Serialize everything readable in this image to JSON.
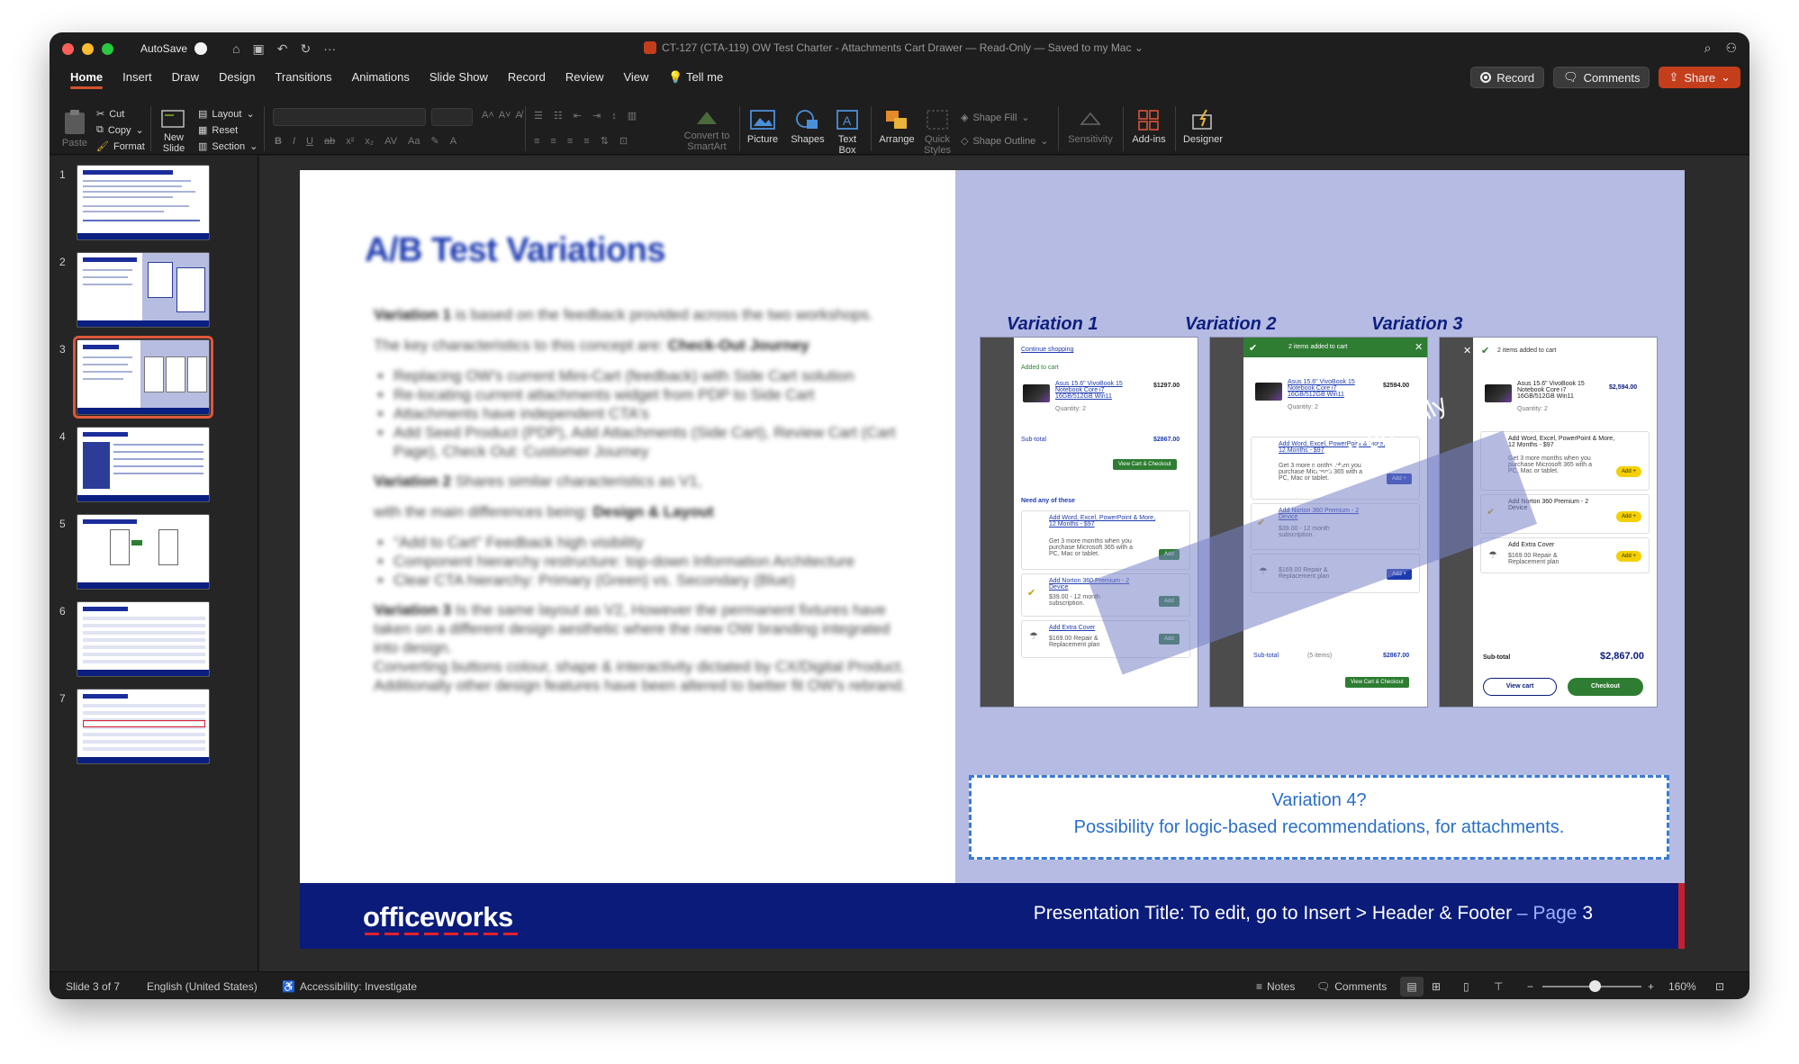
{
  "titlebar": {
    "autosave": "AutoSave",
    "document_title": "CT-127 (CTA-119) OW Test Charter - Attachments Cart Drawer  —  Read-Only  —  Saved to my Mac ⌄"
  },
  "tabs": [
    "Home",
    "Insert",
    "Draw",
    "Design",
    "Transitions",
    "Animations",
    "Slide Show",
    "Record",
    "Review",
    "View",
    "Tell me"
  ],
  "header_buttons": {
    "record": "Record",
    "comments": "Comments",
    "share": "Share"
  },
  "ribbon": {
    "paste": "Paste",
    "cut": "Cut",
    "copy": "Copy",
    "format": "Format",
    "new_slide_1": "New",
    "new_slide_2": "Slide",
    "layout": "Layout",
    "reset": "Reset",
    "section": "Section",
    "convert_1": "Convert to",
    "convert_2": "SmartArt",
    "picture": "Picture",
    "shapes": "Shapes",
    "textbox_1": "Text",
    "textbox_2": "Box",
    "arrange": "Arrange",
    "quick_1": "Quick",
    "quick_2": "Styles",
    "shape_fill": "Shape Fill",
    "shape_outline": "Shape Outline",
    "sensitivity": "Sensitivity",
    "addins": "Add-ins",
    "designer": "Designer"
  },
  "thumbnails": [
    {
      "num": "1",
      "title": "CT-127 OW - Attachments Cart Drawer"
    },
    {
      "num": "2",
      "title": "OW - Attachments Cart Drawer"
    },
    {
      "num": "3",
      "title": "A/B Test Variations"
    },
    {
      "num": "4",
      "title": "Measurement plan"
    },
    {
      "num": "5",
      "title": "Supporting documentation"
    },
    {
      "num": "6",
      "title": "CT-09 Proof tests - Analysis"
    },
    {
      "num": "7",
      "title": "CT-09 Proof tests - Analysis"
    }
  ],
  "slide": {
    "title": "A/B Test Variations",
    "body": {
      "p1_bold": "Variation 1",
      "p1": " is based on the feedback provided across the two workshops.",
      "p2": "The key characteristics to this concept are: ",
      "p2_bold": "Check-Out Journey",
      "bullets1": [
        "Replacing OW's current Mini-Cart (feedback) with Side Cart solution",
        "Re-locating current attachments widget from PDP to Side Cart",
        "Attachments have independent CTA's",
        "Add Seed Product (PDP), Add Attachments (Side Cart), Review Cart (Cart Page), Check Out: Customer Journey"
      ],
      "p3_bold": "Variation 2",
      "p3": " Shares similar characteristics as V1,",
      "p4": "with the main differences being: ",
      "p4_bold": "Design & Layout",
      "bullets2": [
        "\"Add to Cart\" Feedback high visibility",
        "Component hierarchy restructure: top-down Information Architecture",
        "Clear CTA hierarchy: Primary (Green) vs. Secondary (Blue)"
      ],
      "p5_bold": "Variation 3",
      "p5": " Is the same layout as V2, However the permanent fixtures have taken on a different design aesthetic where the new OW branding integrated into design.",
      "p6": "Converting buttons colour, shape & interactivity dictated by CX/Digital Product. Additionally other design features have been altered to better fit OW's rebrand."
    },
    "variations": [
      "Variation 1",
      "Variation 2",
      "Variation 3"
    ],
    "mock": {
      "continue": "Continue shopping",
      "added": "Added to cart",
      "items_added": "2 items added to cart",
      "product": "Asus 15.6\" VivoBook 15 Notebook Core i7 16GB/512GB Win11",
      "qty": "Quantity: 2",
      "price1": "$1297.00",
      "price2": "$2594.00",
      "price3": "$2,594.00",
      "subtotal": "Sub-total",
      "subtotal1": "$2867.00",
      "subtotal3": "$2,867.00",
      "view_cart_checkout": "View Cart & Checkout",
      "view_cart": "View cart",
      "checkout": "Checkout",
      "need_any": "Need any of these",
      "office": "Add Word, Excel, PowerPoint & More, 12 Months - $97",
      "office_desc": "Get 3 more months when you purchase Microsoft 365 with a PC, Mac or tablet.",
      "norton": "Add Norton 360 Premium - 2 Device",
      "norton_desc": "$39.00 - 12 month subscription.",
      "cover": "Add Extra Cover",
      "cover_desc": "$169.00 Repair & Replacement plan",
      "add": "Add",
      "add_plus": "Add +",
      "items_count": "(5 items)"
    },
    "concept": "Concept only",
    "v4_line1": "Variation 4?",
    "v4_line2": "Possibility for logic-based recommendations, for attachments.",
    "logo": "officeworks",
    "footer_text": "Presentation Title: To edit, go to Insert > Header & Footer",
    "footer_page": " – Page ",
    "footer_num": "3"
  },
  "statusbar": {
    "slide": "Slide 3 of 7",
    "language": "English (United States)",
    "accessibility": "Accessibility: Investigate",
    "notes": "Notes",
    "comments": "Comments",
    "zoom": "160%"
  },
  "colors": {
    "brand_blue": "#0a1b7a",
    "accent": "#d35230",
    "slide_panel": "#b5bbe2"
  }
}
